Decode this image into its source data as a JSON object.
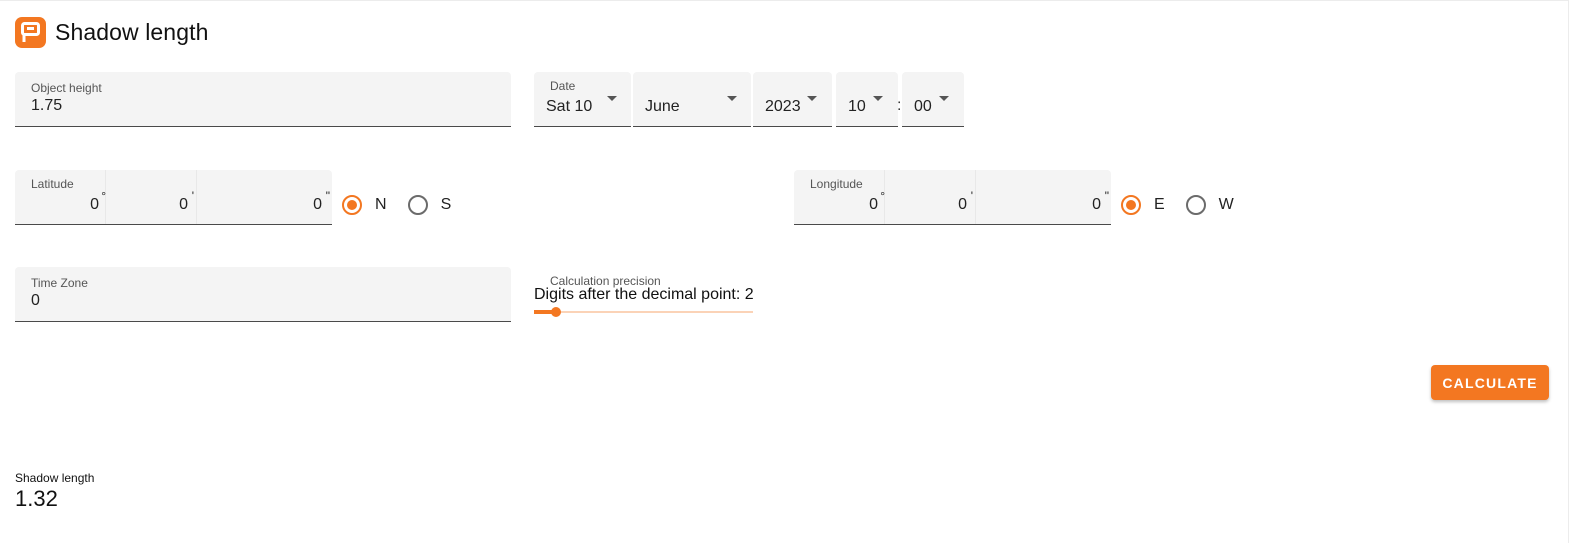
{
  "app": {
    "title": "Shadow length",
    "accent": "#f37721"
  },
  "object_height": {
    "label": "Object height",
    "value": "1.75"
  },
  "date": {
    "label": "Date",
    "day": "Sat 10",
    "month": "June",
    "year": "2023",
    "hour": "10",
    "separator": ":",
    "minute": "00"
  },
  "latitude": {
    "label": "Latitude",
    "degrees": "0",
    "minutes": "0",
    "seconds": "0",
    "deg_unit": "°",
    "min_unit": "'",
    "sec_unit": "\"",
    "options": [
      {
        "label": "N",
        "selected": true
      },
      {
        "label": "S",
        "selected": false
      }
    ]
  },
  "longitude": {
    "label": "Longitude",
    "degrees": "0",
    "minutes": "0",
    "seconds": "0",
    "deg_unit": "°",
    "min_unit": "'",
    "sec_unit": "\"",
    "options": [
      {
        "label": "E",
        "selected": true
      },
      {
        "label": "W",
        "selected": false
      }
    ]
  },
  "time_zone": {
    "label": "Time Zone",
    "value": "0"
  },
  "precision": {
    "label": "Calculation precision",
    "text": "Digits after the decimal point: 2",
    "value": 2
  },
  "actions": {
    "calculate_label": "CALCULATE"
  },
  "result": {
    "label": "Shadow length",
    "value": "1.32"
  }
}
